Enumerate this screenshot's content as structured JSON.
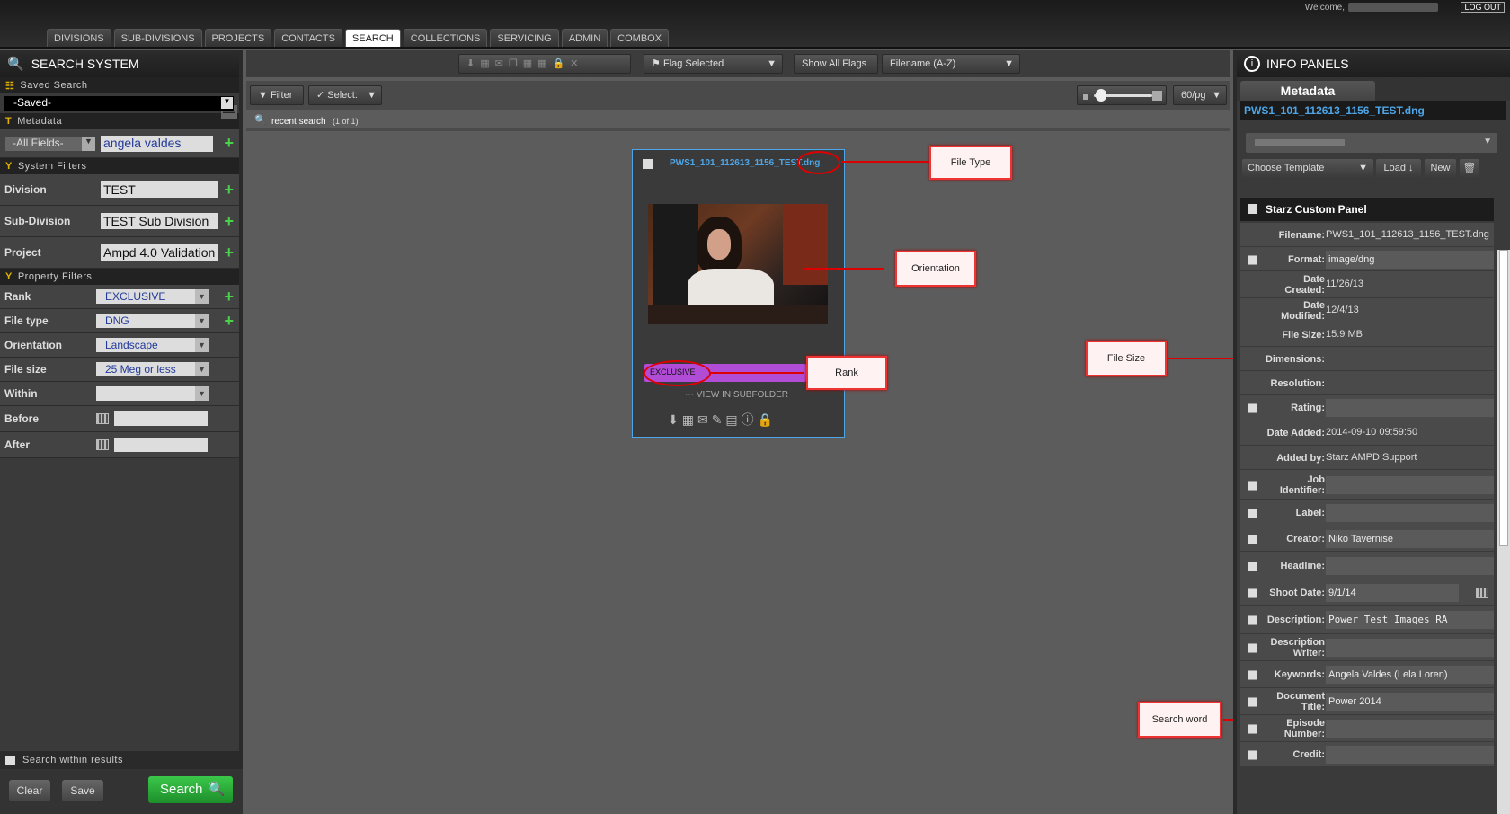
{
  "header": {
    "welcome": "Welcome,",
    "logout": "LOG OUT",
    "tabs": [
      "DIVISIONS",
      "SUB-DIVISIONS",
      "PROJECTS",
      "CONTACTS",
      "SEARCH",
      "COLLECTIONS",
      "SERVICING",
      "ADMIN",
      "COMBOX"
    ],
    "active_tab": "SEARCH"
  },
  "left": {
    "title": "SEARCH SYSTEM",
    "saved_search": {
      "label": "Saved Search",
      "value": "-Saved-"
    },
    "metadata": {
      "label": "Metadata",
      "field": "-All Fields-",
      "value": "angela valdes"
    },
    "system_filters": {
      "label": "System Filters",
      "rows": [
        {
          "label": "Division",
          "value": "TEST"
        },
        {
          "label": "Sub-Division",
          "value": "TEST Sub Division"
        },
        {
          "label": "Project",
          "value": "Ampd 4.0 Validation"
        }
      ]
    },
    "property_filters": {
      "label": "Property Filters",
      "rows": [
        {
          "label": "Rank",
          "value": "EXCLUSIVE"
        },
        {
          "label": "File type",
          "value": "DNG"
        },
        {
          "label": "Orientation",
          "value": "Landscape"
        },
        {
          "label": "File size",
          "value": "25 Meg or less"
        },
        {
          "label": "Within",
          "value": ""
        }
      ],
      "before": "Before",
      "after": "After"
    },
    "search_within": "Search within results",
    "clear": "Clear",
    "save": "Save",
    "search": "Search"
  },
  "center": {
    "flag_selected": "Flag Selected",
    "show_all_flags": "Show All Flags",
    "sort": "Filename (A-Z)",
    "filter": "Filter",
    "select": "Select:",
    "per_page": "60/pg",
    "crumb": "recent search",
    "crumb_count": "(1 of 1)",
    "card": {
      "filename": "PWS1_101_112613_1156_TEST.dng",
      "rank": "EXCLUSIVE",
      "view": "VIEW IN SUBFOLDER"
    }
  },
  "annotations": {
    "file_type": "File Type",
    "orientation": "Orientation",
    "rank": "Rank",
    "file_size": "File Size",
    "search_word": "Search word"
  },
  "right": {
    "title": "INFO PANELS",
    "tab": "Metadata",
    "filename": "PWS1_101_112613_1156_TEST.dng",
    "choose_template": "Choose Template",
    "load": "Load",
    "new": "New",
    "panel_title": "Starz Custom Panel",
    "fields": [
      {
        "k": "Filename:",
        "v": "PWS1_101_112613_1156_TEST.dng"
      },
      {
        "k": "Format:",
        "v": "image/dng"
      },
      {
        "k": "Date Created:",
        "v": "11/26/13"
      },
      {
        "k": "Date Modified:",
        "v": "12/4/13"
      },
      {
        "k": "File Size:",
        "v": "15.9 MB"
      },
      {
        "k": "Dimensions:",
        "v": ""
      },
      {
        "k": "Resolution:",
        "v": ""
      },
      {
        "k": "Rating:",
        "v": ""
      },
      {
        "k": "Date Added:",
        "v": "2014-09-10 09:59:50"
      },
      {
        "k": "Added by:",
        "v": "Starz AMPD Support"
      },
      {
        "k": "Job Identifier:",
        "v": ""
      },
      {
        "k": "Label:",
        "v": ""
      },
      {
        "k": "Creator:",
        "v": "Niko Tavernise"
      },
      {
        "k": "Headline:",
        "v": ""
      },
      {
        "k": "Shoot Date:",
        "v": "9/1/14"
      },
      {
        "k": "Description:",
        "v": "Power Test Images RA"
      },
      {
        "k": "Description Writer:",
        "v": ""
      },
      {
        "k": "Keywords:",
        "v": "Angela Valdes (Lela Loren)"
      },
      {
        "k": "Document Title:",
        "v": "Power 2014"
      },
      {
        "k": "Episode Number:",
        "v": ""
      },
      {
        "k": "Credit:",
        "v": ""
      }
    ]
  }
}
